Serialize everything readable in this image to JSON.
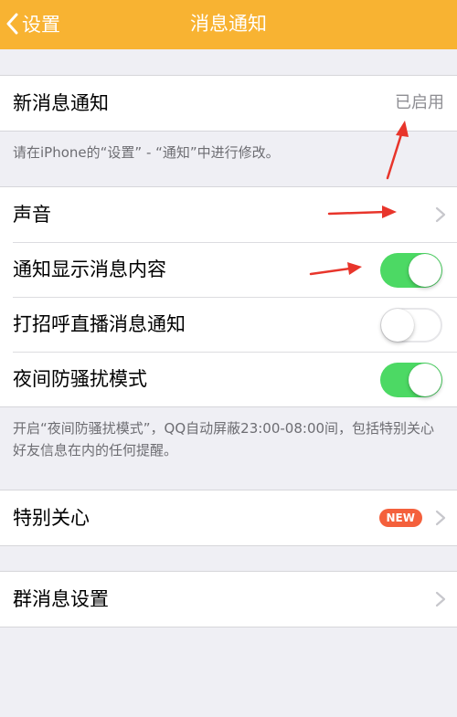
{
  "nav": {
    "back_label": "设置",
    "title": "消息通知"
  },
  "new_message": {
    "label": "新消息通知",
    "value": "已启用",
    "note": "请在iPhone的“设置” - “通知”中进行修改。"
  },
  "settings": {
    "sound": {
      "label": "声音"
    },
    "show_content": {
      "label": "通知显示消息内容",
      "enabled": true
    },
    "live_notify": {
      "label": "打招呼直播消息通知",
      "enabled": false
    },
    "dnd": {
      "label": "夜间防骚扰模式",
      "enabled": true
    },
    "dnd_note": "开启“夜间防骚扰模式”，QQ自动屏蔽23:00-08:00间，包括特别关心好友信息在内的任何提醒。"
  },
  "special_care": {
    "label": "特别关心",
    "badge": "NEW"
  },
  "group_settings": {
    "label": "群消息设置"
  },
  "colors": {
    "nav_bar": "#f8b332",
    "switch_on": "#4cd964",
    "badge": "#f4603c",
    "annotation_arrow": "#e8352b"
  },
  "icons": {
    "back": "chevron-left-icon",
    "disclosure": "chevron-right-icon",
    "annotation": "red-arrow-icon"
  }
}
